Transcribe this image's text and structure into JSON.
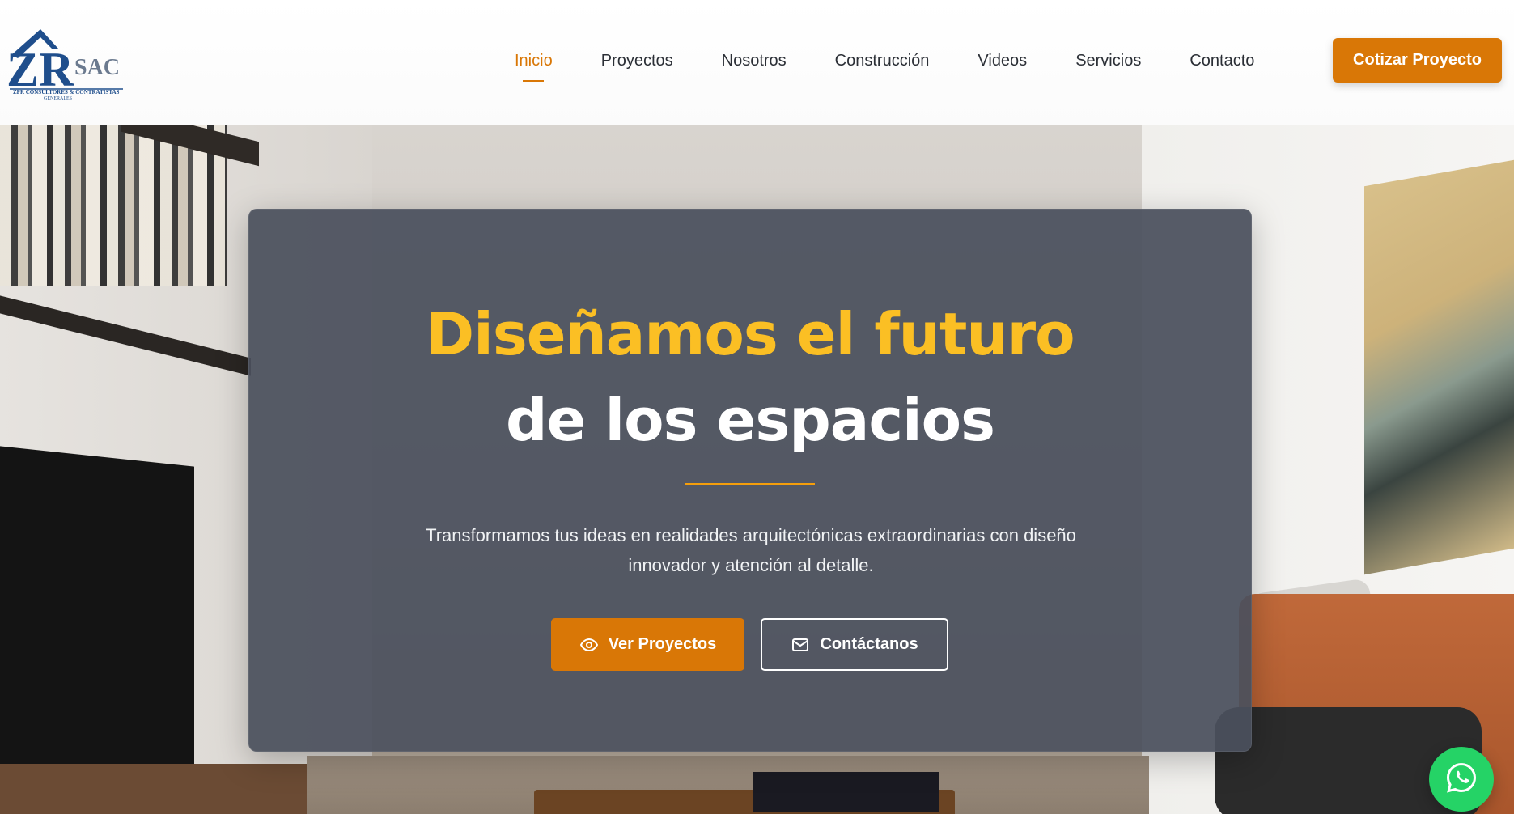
{
  "logo": {
    "mark": "ZR",
    "suffix": "SAC",
    "tagline": "ZPR CONSULTORES & CONTRATISTAS",
    "tagline2": "GENERALES",
    "colors": {
      "primary": "#1f4e8c",
      "secondary": "#6b7a8f"
    }
  },
  "nav": {
    "items": [
      {
        "label": "Inicio",
        "active": true
      },
      {
        "label": "Proyectos",
        "active": false
      },
      {
        "label": "Nosotros",
        "active": false
      },
      {
        "label": "Construcción",
        "active": false
      },
      {
        "label": "Videos",
        "active": false
      },
      {
        "label": "Servicios",
        "active": false
      },
      {
        "label": "Contacto",
        "active": false
      }
    ],
    "cta_label": "Cotizar Proyecto"
  },
  "hero": {
    "title_line1": "Diseñamos el futuro",
    "title_line2": "de los espacios",
    "subtitle": "Transformamos tus ideas en realidades arquitectónicas extraordinarias con diseño innovador y atención al detalle.",
    "primary_button": {
      "label": "Ver Proyectos",
      "icon": "eye-icon"
    },
    "secondary_button": {
      "label": "Contáctanos",
      "icon": "mail-icon"
    }
  },
  "floating": {
    "whatsapp_icon": "whatsapp-icon"
  },
  "colors": {
    "accent": "#d97706",
    "title_yellow": "#fbbf24",
    "card_bg": "#4a505c",
    "whatsapp": "#25d366"
  }
}
